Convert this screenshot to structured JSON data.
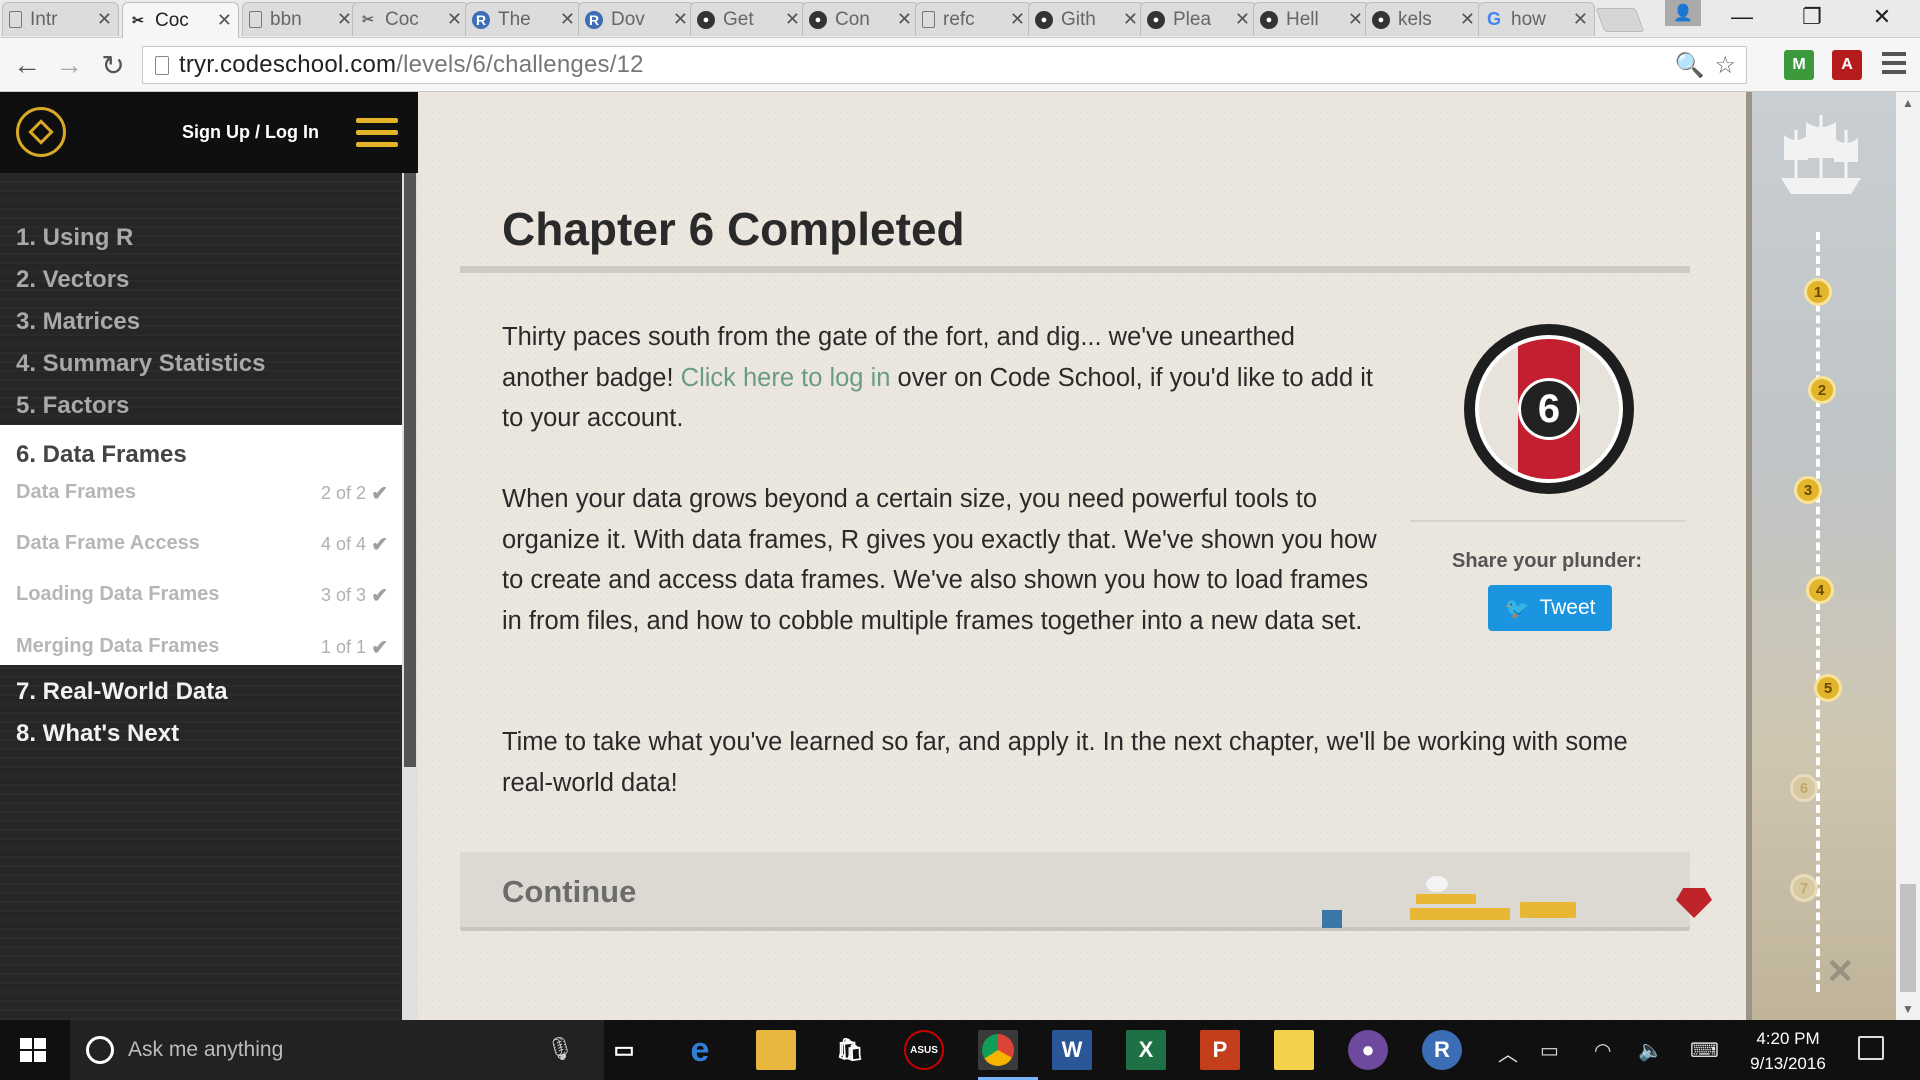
{
  "browser": {
    "tabs": [
      {
        "title": "Intr",
        "icon": "doc"
      },
      {
        "title": "Coc",
        "icon": "codeschool",
        "active": true
      },
      {
        "title": "bbn",
        "icon": "doc"
      },
      {
        "title": "Coc",
        "icon": "codeschool"
      },
      {
        "title": "The",
        "icon": "r"
      },
      {
        "title": "Dov",
        "icon": "r"
      },
      {
        "title": "Get",
        "icon": "github"
      },
      {
        "title": "Con",
        "icon": "github"
      },
      {
        "title": "refc",
        "icon": "doc"
      },
      {
        "title": "Gith",
        "icon": "github"
      },
      {
        "title": "Plea",
        "icon": "github"
      },
      {
        "title": "Hell",
        "icon": "github"
      },
      {
        "title": "kels",
        "icon": "github"
      },
      {
        "title": "how",
        "icon": "google"
      }
    ],
    "url_host": "tryr.codeschool.com",
    "url_path": "/levels/6/challenges/12"
  },
  "sidebar": {
    "signup_label": "Sign Up / Log In",
    "chapters": [
      {
        "label": "1. Using R"
      },
      {
        "label": "2. Vectors"
      },
      {
        "label": "3. Matrices"
      },
      {
        "label": "4. Summary Statistics"
      },
      {
        "label": "5. Factors"
      },
      {
        "label": "6. Data Frames",
        "active": true
      },
      {
        "label": "7. Real-World Data"
      },
      {
        "label": "8. What's Next"
      }
    ],
    "lessons": [
      {
        "label": "Data Frames",
        "count": "2 of 2"
      },
      {
        "label": "Data Frame Access",
        "count": "4 of 4"
      },
      {
        "label": "Loading Data Frames",
        "count": "3 of 3"
      },
      {
        "label": "Merging Data Frames",
        "count": "1 of 1"
      }
    ]
  },
  "main": {
    "title": "Chapter 6 Completed",
    "para1_before": "Thirty paces south from the gate of the fort, and dig... we've unearthed another badge! ",
    "para1_link": "Click here to log in",
    "para1_after": " over on Code School, if you'd like to add it to your account.",
    "para2": "When your data grows beyond a certain size, you need powerful tools to organize it. With data frames, R gives you exactly that. We've shown you how to create and access data frames. We've also shown you how to load frames in from files, and how to cobble multiple frames together into a new data set.",
    "para3": "Time to take what you've learned so far, and apply it. In the next chapter, we'll be working with some real-world data!",
    "badge_number": "6",
    "share_label": "Share your plunder:",
    "tweet_label": "Tweet",
    "continue_label": "Continue"
  },
  "map": {
    "waypoints": [
      "1",
      "2",
      "3",
      "4",
      "5",
      "6",
      "7"
    ]
  },
  "taskbar": {
    "search_placeholder": "Ask me anything",
    "time": "4:20 PM",
    "date": "9/13/2016"
  },
  "colors": {
    "accent_gold": "#e3b42a",
    "link_green": "#6a9b86",
    "tweet_blue": "#1b95e0",
    "badge_red": "#c41f30"
  }
}
